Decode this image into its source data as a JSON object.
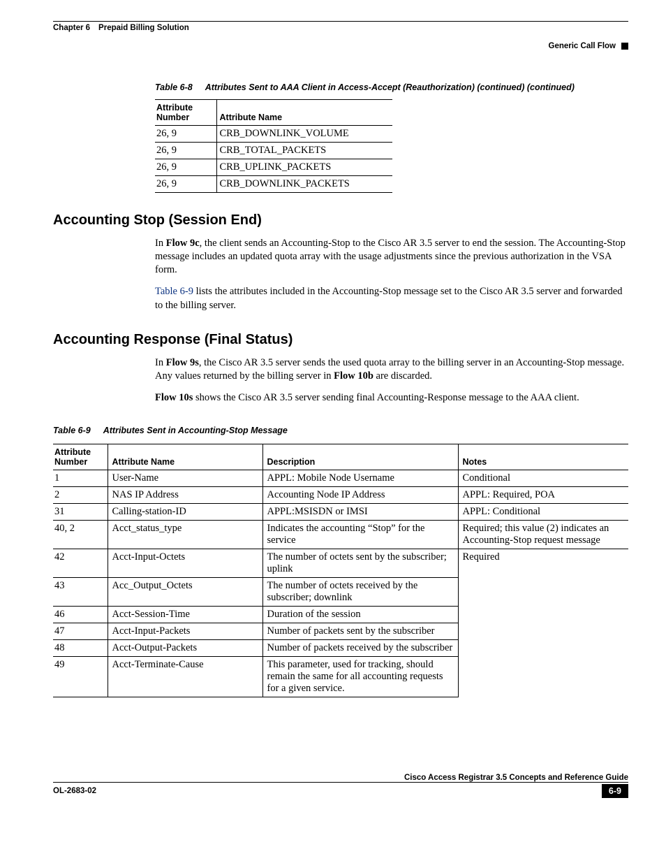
{
  "header": {
    "chapter_label": "Chapter 6",
    "chapter_title": "Prepaid Billing Solution",
    "section_right": "Generic Call Flow"
  },
  "table68": {
    "caption_no": "Table 6-8",
    "caption_title": "Attributes Sent to AAA Client in Access-Accept (Reauthorization) (continued) (continued)",
    "headers": {
      "c1": "Attribute Number",
      "c2": "Attribute Name"
    },
    "rows": [
      {
        "num": "26, 9",
        "name": "CRB_DOWNLINK_VOLUME"
      },
      {
        "num": "26, 9",
        "name": "CRB_TOTAL_PACKETS"
      },
      {
        "num": "26, 9",
        "name": "CRB_UPLINK_PACKETS"
      },
      {
        "num": "26, 9",
        "name": "CRB_DOWNLINK_PACKETS"
      }
    ]
  },
  "section1": {
    "heading": "Accounting Stop (Session End)",
    "p1a": "In ",
    "p1b": "Flow 9c",
    "p1c": ", the client sends an Accounting-Stop to the Cisco AR 3.5 server to end the session. The Accounting-Stop message includes an updated quota array with the usage adjustments since the previous authorization in the VSA form.",
    "p2a": "Table 6-9",
    "p2b": " lists the attributes included in the Accounting-Stop message set to the Cisco AR 3.5 server and forwarded to the billing server."
  },
  "section2": {
    "heading": "Accounting Response (Final Status)",
    "p1a": "In ",
    "p1b": "Flow 9s",
    "p1c": ", the Cisco AR 3.5 server sends the used quota array to the billing server in an Accounting-Stop message. Any values returned by the billing server in ",
    "p1d": "Flow 10b",
    "p1e": " are discarded.",
    "p2a": "Flow 10s",
    "p2b": " shows the Cisco AR 3.5 server sending final Accounting-Response message to the AAA client."
  },
  "table69": {
    "caption_no": "Table 6-9",
    "caption_title": "Attributes Sent in Accounting-Stop Message",
    "headers": {
      "c1": "Attribute Number",
      "c2": "Attribute Name",
      "c3": "Description",
      "c4": "Notes"
    },
    "rows": [
      {
        "num": "1",
        "name": "User-Name",
        "desc": "APPL: Mobile Node Username",
        "notes": "Conditional"
      },
      {
        "num": "2",
        "name": "NAS IP Address",
        "desc": "Accounting Node IP Address",
        "notes": "APPL: Required, POA"
      },
      {
        "num": "31",
        "name": "Calling-station-ID",
        "desc": "APPL:MSISDN or IMSI",
        "notes": "APPL: Conditional"
      },
      {
        "num": "40, 2",
        "name": "Acct_status_type",
        "desc": "Indicates the accounting “Stop” for the service",
        "notes": "Required; this value (2) indicates an Accounting-Stop request message"
      },
      {
        "num": "42",
        "name": "Acct-Input-Octets",
        "desc": "The number of octets sent by the subscriber; uplink",
        "notes": "Required"
      },
      {
        "num": "43",
        "name": "Acc_Output_Octets",
        "desc": "The number of octets received by the subscriber; downlink",
        "notes": ""
      },
      {
        "num": "46",
        "name": "Acct-Session-Time",
        "desc": "Duration of the session",
        "notes": ""
      },
      {
        "num": "47",
        "name": "Acct-Input-Packets",
        "desc": "Number of packets sent by the subscriber",
        "notes": ""
      },
      {
        "num": "48",
        "name": "Acct-Output-Packets",
        "desc": "Number of packets received by the subscriber",
        "notes": ""
      },
      {
        "num": "49",
        "name": "Acct-Terminate-Cause",
        "desc": "This parameter, used for tracking, should remain the same for all accounting requests for a given service.",
        "notes": ""
      }
    ]
  },
  "footer": {
    "book_title": "Cisco Access Registrar 3.5 Concepts and Reference Guide",
    "doc_id": "OL-2683-02",
    "page_no": "6-9"
  }
}
